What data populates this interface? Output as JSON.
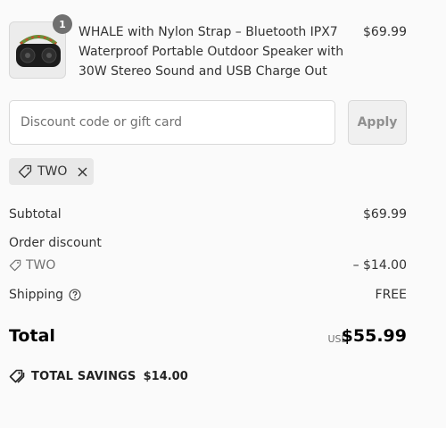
{
  "product": {
    "quantity": "1",
    "title": "WHALE with Nylon Strap – Bluetooth IPX7 Waterproof Portable Outdoor Speaker with 30W Stereo Sound and USB Charge Out",
    "price": "$69.99"
  },
  "discount": {
    "placeholder": "Discount code or gift card",
    "apply_label": "Apply",
    "applied_code": "TWO"
  },
  "summary": {
    "subtotal_label": "Subtotal",
    "subtotal_value": "$69.99",
    "order_discount_label": "Order discount",
    "discount_code": "TWO",
    "discount_value": "– $14.00",
    "shipping_label": "Shipping",
    "shipping_value": "FREE",
    "total_label": "Total",
    "total_currency": "USD",
    "total_value": "$55.99",
    "savings_label": "TOTAL SAVINGS",
    "savings_value": "$14.00"
  },
  "icons": {
    "tag": "tag-icon",
    "close": "close-icon",
    "help": "help-circle-icon",
    "savings": "savings-tag-icon"
  },
  "colors": {
    "background": "#fafafa",
    "chip_background": "#e8e8e8",
    "badge": "#707070",
    "text": "#333333",
    "muted": "#707070"
  }
}
